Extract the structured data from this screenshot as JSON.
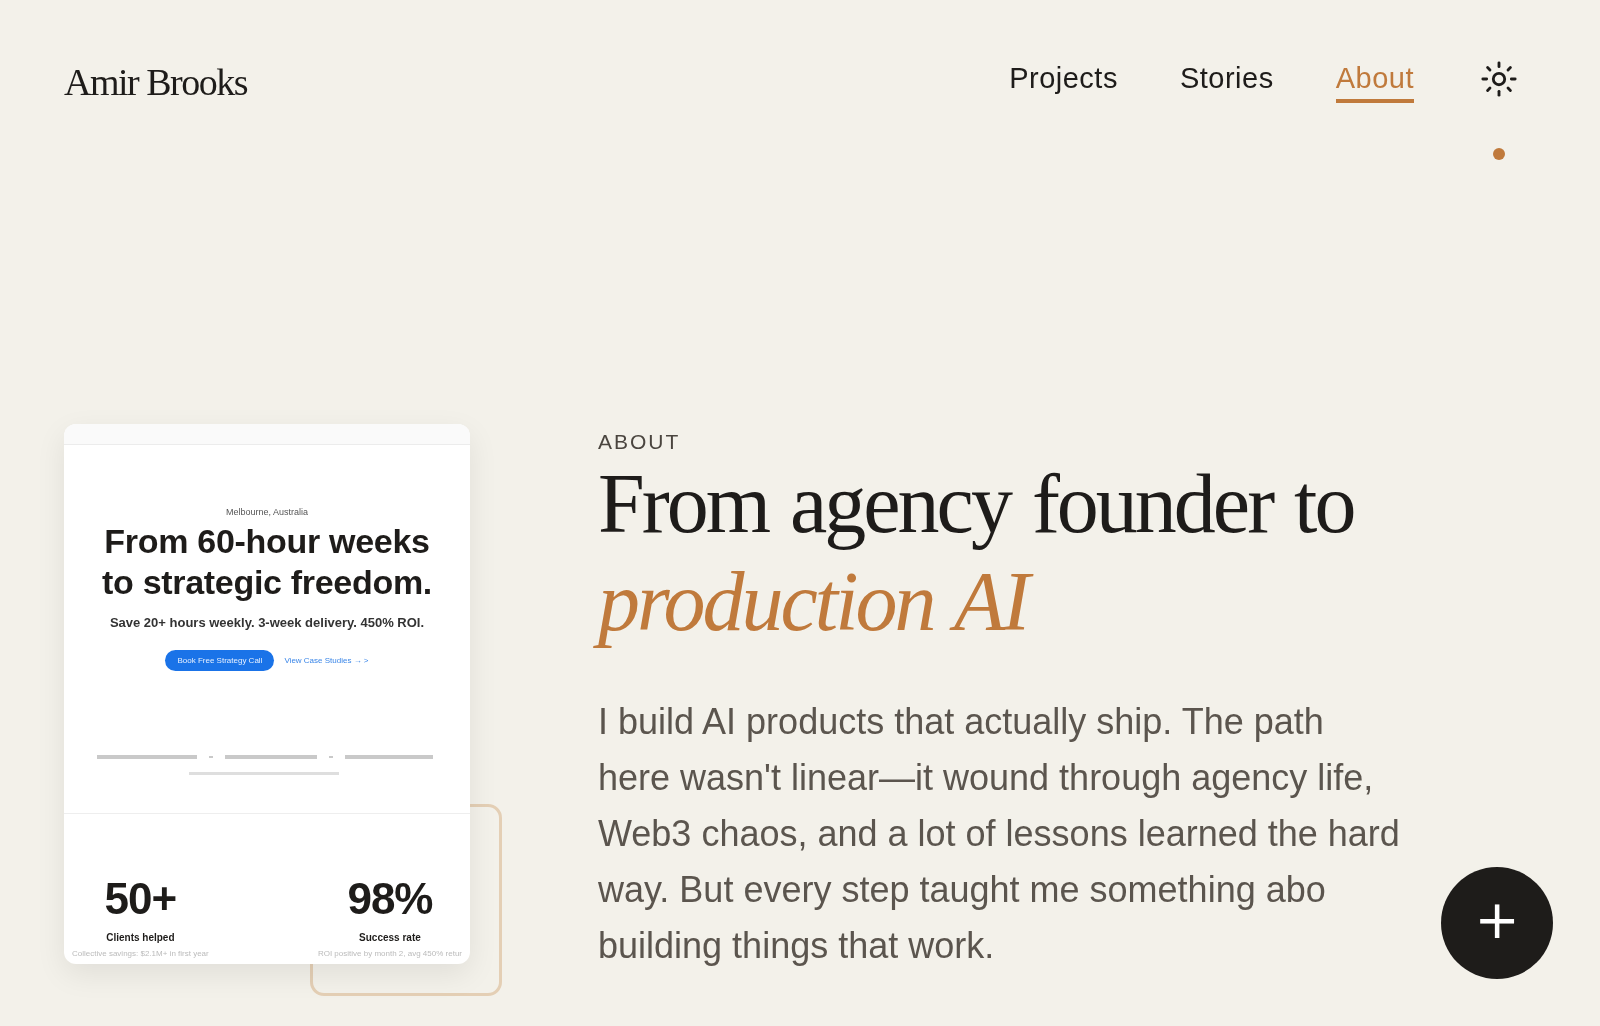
{
  "header": {
    "logo": "Amir Brooks",
    "nav": [
      {
        "label": "Projects",
        "selected": false
      },
      {
        "label": "Stories",
        "selected": false
      },
      {
        "label": "About",
        "selected": true
      }
    ],
    "indicator_dot": true
  },
  "preview": {
    "location": "Melbourne, Australia",
    "headline": "From 60-hour weeks to strategic freedom.",
    "subhead": "Save 20+ hours weekly. 3-week delivery. 450% ROI.",
    "primary_button": "Book Free Strategy Call",
    "secondary_link": "View Case Studies → >",
    "stats": [
      {
        "value": "50+",
        "label": "Clients helped",
        "note": "Collective savings: $2.1M+ in first year"
      },
      {
        "value": "98%",
        "label": "Success rate",
        "note": "ROI positive by month 2, avg 450% retur"
      }
    ]
  },
  "about": {
    "eyebrow": "ABOUT",
    "title_plain": "From agency founder to",
    "title_accent": "production AI",
    "paragraph_lines": [
      "I build AI products that actually ship. The path",
      "here wasn't linear—it wound through agency life,",
      "Web3 chaos, and a lot of lessons learned the hard",
      "way. But every step taught me something abo",
      "building things that work."
    ]
  },
  "fab": {
    "symbol": "+"
  }
}
